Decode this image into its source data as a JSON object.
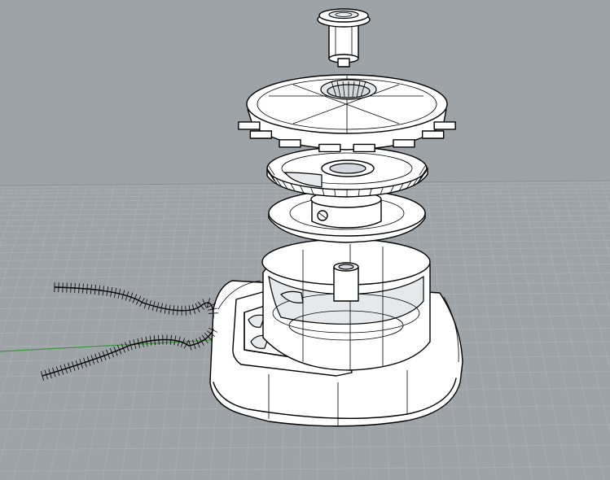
{
  "viewport": {
    "background_color": "#9ea3a8",
    "grid_color": "#a9aeb3",
    "axis_x_color": "#3a9a3a",
    "object_fill": "#ffffff",
    "wire_color": "#000000"
  },
  "scene": {
    "objects": [
      "grinder-top-knob",
      "grinder-lid",
      "burr-gear",
      "burr-plate",
      "grinder-cup",
      "grinder-base",
      "power-cable"
    ]
  }
}
